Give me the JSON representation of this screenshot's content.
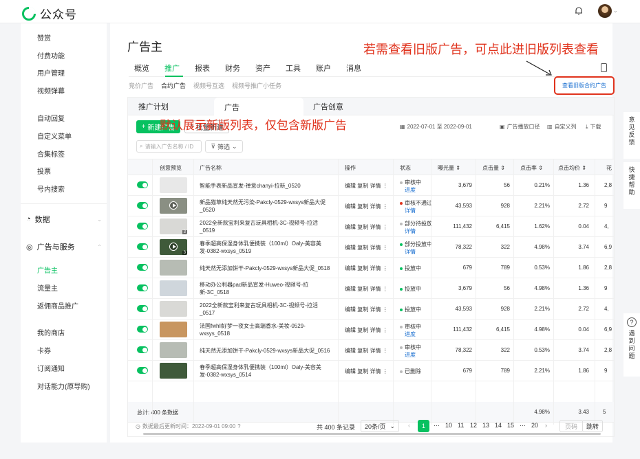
{
  "app": {
    "name": "公众号"
  },
  "sidebar": {
    "items_top": [
      "赞赏",
      "付费功能",
      "用户管理",
      "视频弹幕"
    ],
    "items_mid": [
      "自动回复",
      "自定义菜单",
      "合集标签",
      "投票",
      "号内搜索"
    ],
    "group_data": "数据",
    "group_ads": "广告与服务",
    "ads_items": [
      "广告主",
      "流量主",
      "返佣商品推广"
    ],
    "items_bottom": [
      "我的商店",
      "卡券",
      "订阅通知",
      "对话能力(原导购)"
    ]
  },
  "page": {
    "title": "广告主"
  },
  "nav_tabs": [
    "概览",
    "推广",
    "报表",
    "财务",
    "资产",
    "工具",
    "账户",
    "消息"
  ],
  "sub_tabs": [
    "竞价广告",
    "合约广告",
    "视频号互选",
    "视频号推广小任务"
  ],
  "old_link": "查看旧版合约广告",
  "annotations": {
    "top": "若需查看旧版广告，可点此进旧版列表查看",
    "middle": "默认展示新版列表，仅包含新版广告"
  },
  "panel_tabs": [
    "推广计划",
    "广告",
    "广告创意"
  ],
  "buttons": {
    "new": "新建广告",
    "batch": "批量新建"
  },
  "search": {
    "placeholder": "请输入广告名称 / ID",
    "filter": "筛选"
  },
  "toolbar": {
    "date_range": "2022-07-01 至 2022-09-01",
    "caliber": "广告播放口径",
    "custom_cols": "自定义列",
    "download": "下载"
  },
  "columns": [
    "创意预览",
    "广告名称",
    "操作",
    "状态",
    "曝光量",
    "点击量",
    "点击率",
    "点击均价",
    "花"
  ],
  "ops_labels": {
    "edit": "编辑",
    "copy": "复制",
    "detail": "详情"
  },
  "rows": [
    {
      "name": "智能手表新品宣发-禅意chanyi-拉新_0520",
      "status": "审核中",
      "status_sub": "进度",
      "status_color": "#bbbbbb",
      "impressions": "3,679",
      "clicks": "56",
      "ctr": "0.21%",
      "cpc": "1.36",
      "spend": "2,8",
      "thumb": "#e8e8e8",
      "video": false
    },
    {
      "name": "新品猫草纯天然无污染-Pakcly-0529-wxsys新品大促_0520",
      "status": "审核不通过",
      "status_sub": "详情",
      "status_color": "#e0321c",
      "impressions": "43,593",
      "clicks": "928",
      "ctr": "2.21%",
      "cpc": "2.72",
      "spend": "9",
      "thumb": "#8a8f83",
      "video": true,
      "count": ""
    },
    {
      "name": "2022全新款宝利来复古玩具相机-3C-视频号-拉活_0519",
      "status": "部分待投放",
      "status_sub": "详情",
      "status_color": "#bbbbbb",
      "impressions": "111,432",
      "clicks": "6,415",
      "ctr": "1.62%",
      "cpc": "0.04",
      "spend": "4,",
      "thumb": "#d9d9d6",
      "video": false,
      "count": "3"
    },
    {
      "name": "春季超高保湿身体乳便携装（100ml）Oaly-美容美发-0382-wxsys_0519",
      "status": "部分投放中",
      "status_sub": "详情",
      "status_color": "#07c160",
      "impressions": "78,322",
      "clicks": "322",
      "ctr": "4.98%",
      "cpc": "3.74",
      "spend": "6,9",
      "thumb": "#3f5a3a",
      "video": true,
      "count": "3"
    },
    {
      "name": "纯天然无添加饼干-Pakcly-0529-wxsys新品大促_0518",
      "status": "投放中",
      "status_sub": "",
      "status_color": "#07c160",
      "impressions": "679",
      "clicks": "789",
      "ctr": "0.53%",
      "cpc": "1.86",
      "spend": "2,8",
      "thumb": "#b7bcb4",
      "video": false
    },
    {
      "name": "移动办公利器pad新品宣发-Huweo-视频号-拉新-3C_0518",
      "status": "投放中",
      "status_sub": "",
      "status_color": "#07c160",
      "impressions": "3,679",
      "clicks": "56",
      "ctr": "4.98%",
      "cpc": "1.36",
      "spend": "9",
      "thumb": "#cfd6dc",
      "video": false
    },
    {
      "name": "2022全新款宝利来复古玩具相机-3C-视频号-拉活_0517",
      "status": "投放中",
      "status_sub": "",
      "status_color": "#07c160",
      "impressions": "43,593",
      "clicks": "928",
      "ctr": "2.21%",
      "cpc": "2.72",
      "spend": "4,",
      "thumb": "#d9d9d6",
      "video": false
    },
    {
      "name": "法国fwhll好梦一夜女士高端香水-美妆-0529-wxsys_0518",
      "status": "审核中",
      "status_sub": "进度",
      "status_color": "#bbbbbb",
      "impressions": "111,432",
      "clicks": "6,415",
      "ctr": "4.98%",
      "cpc": "0.04",
      "spend": "6,9",
      "thumb": "#c89660",
      "video": false
    },
    {
      "name": "纯天然无添加饼干-Pakcly-0529-wxsys新品大促_0516",
      "status": "审核中",
      "status_sub": "进度",
      "status_color": "#bbbbbb",
      "impressions": "78,322",
      "clicks": "322",
      "ctr": "0.53%",
      "cpc": "3.74",
      "spend": "2,8",
      "thumb": "#b7bcb4",
      "video": false
    },
    {
      "name": "春季超高保湿身体乳便携装（100ml）Oaly-美容美发-0382-wxsys_0514",
      "status": "已删除",
      "status_sub": "",
      "status_color": "#bbbbbb",
      "impressions": "679",
      "clicks": "789",
      "ctr": "2.21%",
      "cpc": "1.86",
      "spend": "9",
      "thumb": "#3f5a3a",
      "video": false
    }
  ],
  "total": {
    "label": "总计: 400 条数据",
    "ctr": "4.98%",
    "cpc": "3.43",
    "spend": "5"
  },
  "footer": {
    "updated": "数据最后更新时间：2022-09-01 09:00"
  },
  "pager": {
    "records": "共 400 条记录",
    "per_page": "20条/页",
    "pages": [
      "1",
      "···",
      "10",
      "11",
      "12",
      "13",
      "14",
      "15",
      "···",
      "20"
    ],
    "goto": "页码",
    "jump": "跳转"
  },
  "float": {
    "feedback": "意见反馈",
    "help": "快捷帮助",
    "problem": "遇到问题"
  }
}
